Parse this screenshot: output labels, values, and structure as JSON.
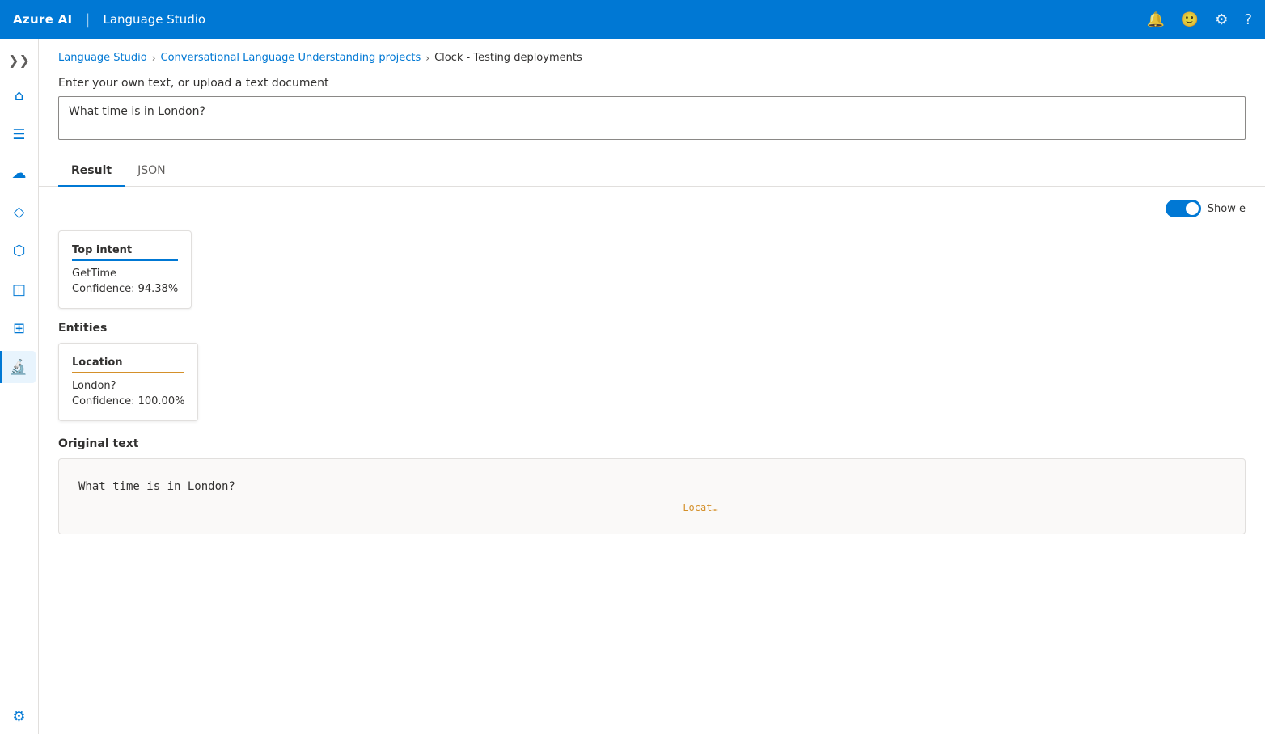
{
  "topNav": {
    "brand": "Azure AI",
    "divider": "|",
    "app": "Language Studio",
    "icons": {
      "bell": "🔔",
      "smiley": "🙂",
      "settings": "⚙",
      "help": "?"
    }
  },
  "breadcrumb": {
    "items": [
      {
        "label": "Language Studio",
        "link": true
      },
      {
        "label": "Conversational Language Understanding projects",
        "link": true
      },
      {
        "label": "Clock - Testing deployments",
        "link": false
      }
    ]
  },
  "inputSection": {
    "label": "Enter your own text, or upload a text document",
    "placeholder": "What time is in London?",
    "value": "What time is in London?"
  },
  "tabs": [
    {
      "label": "Result",
      "active": true
    },
    {
      "label": "JSON",
      "active": false
    }
  ],
  "toggleLabel": "Show e",
  "results": {
    "topIntent": {
      "title": "Top intent",
      "value": "GetTime",
      "confidence": "Confidence: 94.38%"
    },
    "entities": {
      "sectionTitle": "Entities",
      "items": [
        {
          "title": "Location",
          "value": "London?",
          "confidence": "Confidence: 100.00%"
        }
      ]
    },
    "originalText": {
      "sectionTitle": "Original text",
      "text": "What time is in London?",
      "prefix": "What time is in ",
      "highlighted": "London?",
      "entityLabel": "Locat…"
    }
  },
  "sidebar": {
    "items": [
      {
        "icon": "≡",
        "name": "menu-toggle"
      },
      {
        "icon": "⌂",
        "name": "home"
      },
      {
        "icon": "≡",
        "name": "list"
      },
      {
        "icon": "☁",
        "name": "cloud"
      },
      {
        "icon": "◇",
        "name": "diamond"
      },
      {
        "icon": "⬡",
        "name": "hexagon"
      },
      {
        "icon": "◫",
        "name": "box"
      },
      {
        "icon": "⊞",
        "name": "grid-plus"
      },
      {
        "icon": "🔬",
        "name": "lab",
        "active": true
      },
      {
        "icon": "⚙",
        "name": "settings"
      }
    ]
  }
}
